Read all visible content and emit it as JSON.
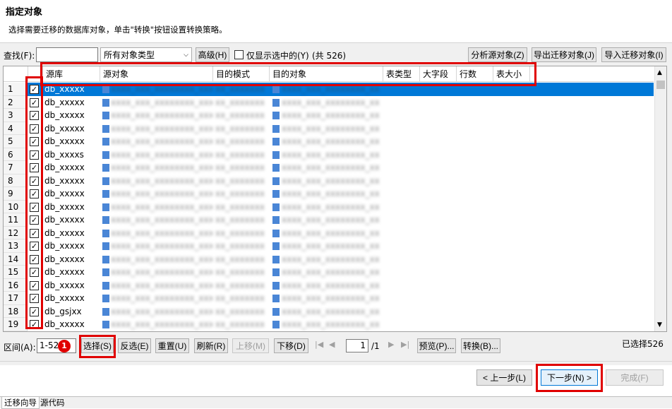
{
  "header": {
    "title": "指定对象",
    "subtitle": "选择需要迁移的数据库对象，单击\"转换\"按钮设置转换策略。"
  },
  "toolbar": {
    "find_label": "查找(F):",
    "find_value": "",
    "type_select": "所有对象类型",
    "advanced_button": "高级(H)",
    "only_selected_label": "仅显示选中的(Y)",
    "total_count": "(共 526)",
    "analyze_button": "分析源对象(Z)",
    "export_button": "导出迁移对象(J)",
    "import_button": "导入迁移对象(I)"
  },
  "grid": {
    "columns": [
      "源库",
      "源对象",
      "目的模式",
      "目的对象",
      "表类型",
      "大字段",
      "行数",
      "表大小"
    ],
    "rows": [
      {
        "num": "1",
        "src_db": "db_xxxxx",
        "selected": true
      },
      {
        "num": "2",
        "src_db": "db_xxxxx",
        "selected": false
      },
      {
        "num": "3",
        "src_db": "db_xxxxx",
        "selected": false
      },
      {
        "num": "4",
        "src_db": "db_xxxxx",
        "selected": false
      },
      {
        "num": "5",
        "src_db": "db_xxxxx",
        "selected": false
      },
      {
        "num": "6",
        "src_db": "db_xxxxs",
        "selected": false
      },
      {
        "num": "7",
        "src_db": "db_xxxxx",
        "selected": false
      },
      {
        "num": "8",
        "src_db": "db_xxxxx",
        "selected": false
      },
      {
        "num": "9",
        "src_db": "db_xxxxx",
        "selected": false
      },
      {
        "num": "10",
        "src_db": "db_xxxxx",
        "selected": false
      },
      {
        "num": "11",
        "src_db": "db_xxxxx",
        "selected": false
      },
      {
        "num": "12",
        "src_db": "db_xxxxx",
        "selected": false
      },
      {
        "num": "13",
        "src_db": "db_xxxxx",
        "selected": false
      },
      {
        "num": "14",
        "src_db": "db_xxxxx",
        "selected": false
      },
      {
        "num": "15",
        "src_db": "db_xxxxx",
        "selected": false
      },
      {
        "num": "16",
        "src_db": "db_xxxxx",
        "selected": false
      },
      {
        "num": "17",
        "src_db": "db_xxxxx",
        "selected": false
      },
      {
        "num": "18",
        "src_db": "db_gsjxx",
        "selected": false
      },
      {
        "num": "19",
        "src_db": "db_xxxxx",
        "selected": false
      }
    ],
    "blurred_src_obj": "xxxx_xxx_xxxxxxxx_xxx",
    "blurred_dst_schema": "xx_xxxxxxx",
    "blurred_dst_obj": "xxxx_xxx_xxxxxxxx_xx"
  },
  "pager": {
    "range_label": "区间(A):",
    "range_value": "1-52",
    "select_button": "选择(S)",
    "invert_button": "反选(E)",
    "reset_button": "重置(U)",
    "refresh_button": "刷新(R)",
    "move_up_button": "上移(M)",
    "move_down_button": "下移(D)",
    "page_value": "1",
    "page_total": "/1",
    "preview_button": "预览(P)...",
    "convert_button": "转换(B)...",
    "selected_count": "已选择526"
  },
  "annotation": {
    "badge": "1"
  },
  "footer": {
    "prev_button": "< 上一步(L)",
    "next_button": "下一步(N) >",
    "finish_button": "完成(F)"
  },
  "tabs": [
    "迁移向导",
    "源代码"
  ],
  "colors": {
    "selection": "#0078d7",
    "highlight": "#e00000"
  }
}
